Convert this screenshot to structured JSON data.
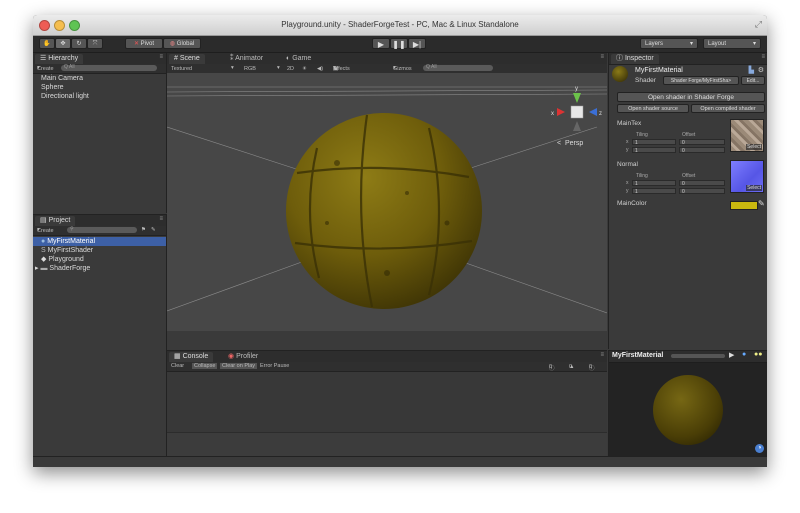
{
  "window": {
    "title": "Playground.unity - ShaderForgeTest - PC, Mac & Linux Standalone",
    "resize_icon": "resize-diagonal-icon"
  },
  "toolbar": {
    "pivot_label": "Pivot",
    "global_label": "Global",
    "layers_label": "Layers",
    "layout_label": "Layout"
  },
  "hierarchy": {
    "tab_label": "Hierarchy",
    "create_label": "Create",
    "search_placeholder": "Q All",
    "items": [
      "Main Camera",
      "Sphere",
      "Directional light"
    ]
  },
  "scene": {
    "tabs": [
      "Scene",
      "Animator",
      "Game"
    ],
    "render_mode": "Textured",
    "color_mode": "RGB",
    "mode_2d": "2D",
    "effects_label": "Effects",
    "gizmos_label": "Gizmos",
    "gizmo_search": "Q All",
    "persp_label": "Persp",
    "axis_y": "y",
    "axis_x": "x",
    "axis_z": "z",
    "colors": {
      "sphere": "#7d6a0c",
      "background": "#474747"
    }
  },
  "project": {
    "tab_label": "Project",
    "create_label": "Create",
    "items": [
      "MyFirstMaterial",
      "MyFirstShader",
      "Playground",
      "ShaderForge"
    ],
    "selected_index": 0
  },
  "console": {
    "tabs": [
      "Console",
      "Profiler"
    ],
    "buttons": [
      "Clear",
      "Collapse",
      "Clear on Play",
      "Error Pause"
    ],
    "counts": {
      "info": "0",
      "warnings": "0",
      "errors": "0"
    }
  },
  "inspector": {
    "tab_label": "Inspector",
    "material_name": "MyFirstMaterial",
    "shader_label": "Shader",
    "shader_value": "Shader Forge/MyFirstSha>",
    "edit_label": "Edit...",
    "open_sf_button": "Open shader in Shader Forge",
    "open_source_button": "Open shader source",
    "open_compiled_button": "Open compiled shader",
    "properties": [
      {
        "name": "MainTex",
        "tiling_label": "Tiling",
        "offset_label": "Offset",
        "x_label": "x",
        "y_label": "y",
        "tiling_x": "1",
        "tiling_y": "1",
        "offset_x": "0",
        "offset_y": "0",
        "select_label": "Select"
      },
      {
        "name": "Normal",
        "tiling_label": "Tiling",
        "offset_label": "Offset",
        "x_label": "x",
        "y_label": "y",
        "tiling_x": "1",
        "tiling_y": "1",
        "offset_x": "0",
        "offset_y": "0",
        "select_label": "Select"
      }
    ],
    "main_color_label": "MainColor",
    "main_color": "#c9b80f",
    "preview_title": "MyFirstMaterial"
  }
}
